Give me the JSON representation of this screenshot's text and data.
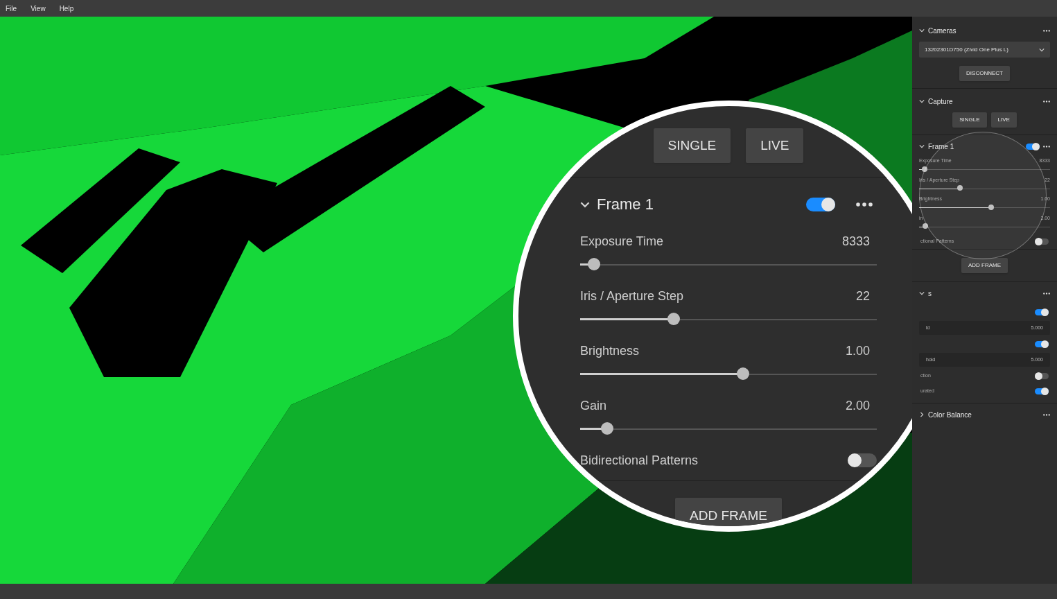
{
  "menu": [
    "File",
    "View",
    "Help"
  ],
  "cameras": {
    "title": "Cameras",
    "expanded": true,
    "device": "13202301D750 (Zivid One Plus L)",
    "button": "DISCONNECT"
  },
  "capture": {
    "title": "Capture",
    "expanded": true,
    "buttons": [
      "SINGLE",
      "LIVE"
    ]
  },
  "frame": {
    "title": "Frame 1",
    "expanded": true,
    "enabled": true,
    "rows": [
      {
        "kind": "slider",
        "label": "Exposure Time",
        "value": "8333",
        "level": 0.04
      },
      {
        "kind": "slider",
        "label": "Iris / Aperture Step",
        "value": "22",
        "level": 0.31
      },
      {
        "kind": "slider",
        "label": "Brightness",
        "value": "1.00",
        "level": 0.55
      },
      {
        "kind": "slider",
        "label": "in",
        "value": "2.00",
        "level": 0.05
      },
      {
        "kind": "toggle",
        "label": "ctional Patterns",
        "on": false
      }
    ],
    "button": "ADD FRAME"
  },
  "filters": {
    "title": "s",
    "expanded": true,
    "rows": [
      {
        "kind": "toggle",
        "on": true
      },
      {
        "kind": "field",
        "label": "ld",
        "value": "5.000"
      },
      {
        "kind": "toggle",
        "on": true
      },
      {
        "kind": "field",
        "label": "hold",
        "value": "5.000"
      },
      {
        "kind": "toggle",
        "label": "ction",
        "on": false
      },
      {
        "kind": "toggle",
        "label": "urated",
        "on": true
      }
    ]
  },
  "color_balance": {
    "title": "Color Balance",
    "expanded": false
  },
  "magnifier": {
    "buttons": [
      "SINGLE",
      "LIVE"
    ],
    "frame": {
      "title": "Frame 1",
      "expanded": true,
      "enabled": true,
      "rows": [
        {
          "kind": "slider",
          "label": "Exposure Time",
          "value": "8333",
          "level": 0.047
        },
        {
          "kind": "slider",
          "label": "Iris / Aperture Step",
          "value": "22",
          "level": 0.315
        },
        {
          "kind": "slider",
          "label": "Brightness",
          "value": "1.00",
          "level": 0.55
        },
        {
          "kind": "slider",
          "label": "Gain",
          "value": "2.00",
          "level": 0.09
        },
        {
          "kind": "toggle",
          "label": "Bidirectional Patterns",
          "on": false
        }
      ]
    },
    "button": "ADD FRAME"
  }
}
